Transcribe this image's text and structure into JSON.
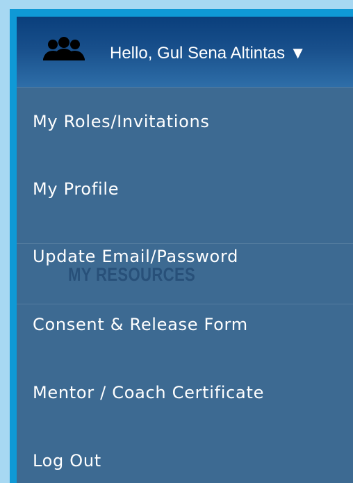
{
  "header": {
    "greeting": "Hello, Gul Sena Altintas ▼"
  },
  "menu": {
    "items": [
      {
        "label": "My Roles/Invitations"
      },
      {
        "label": "My Profile"
      },
      {
        "label": "Update Email/Password"
      },
      {
        "label": "Consent & Release Form"
      },
      {
        "label": "Mentor / Coach Certificate"
      },
      {
        "label": "Log Out"
      }
    ]
  },
  "background": {
    "heading": "MY RESOURCES"
  },
  "icons": {
    "user_group": "user-group-icon",
    "caret": "caret-down-icon"
  },
  "colors": {
    "page_background": "#a7d8f2",
    "frame": "#0f99d6",
    "header_top": "#0a3f7c",
    "header_bottom": "#2e6ea8",
    "menu_background": "#3d6a92",
    "text": "#ffffff"
  }
}
